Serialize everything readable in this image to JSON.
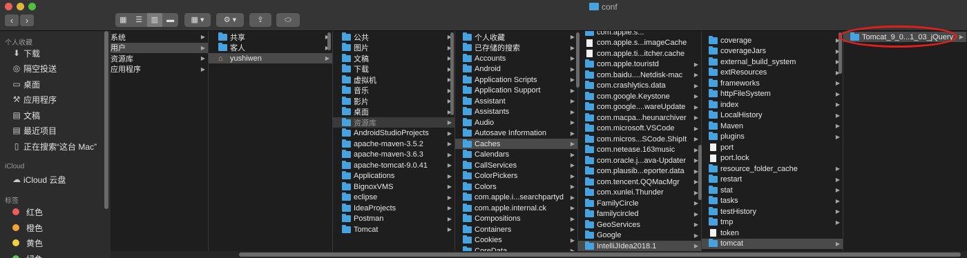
{
  "window": {
    "title": "conf"
  },
  "toolbar": {
    "back": "‹",
    "forward": "›",
    "view_icons": "▦",
    "view_list": "☰",
    "view_columns": "▥",
    "view_gallery": "▬",
    "arrange": "▦ ▾",
    "action": "⚙ ▾",
    "share": "⇪",
    "tag": "⬭"
  },
  "sidebar": {
    "favorites_header": "个人收藏",
    "favorites": [
      {
        "label": "下载",
        "icon": "download-icon",
        "glyph": "⬇"
      },
      {
        "label": "隔空投送",
        "icon": "airdrop-icon",
        "glyph": "◎"
      },
      {
        "label": "桌面",
        "icon": "desktop-icon",
        "glyph": "▭"
      },
      {
        "label": "应用程序",
        "icon": "applications-icon",
        "glyph": "⚒"
      },
      {
        "label": "文稿",
        "icon": "documents-icon",
        "glyph": "▤"
      },
      {
        "label": "最近项目",
        "icon": "recents-icon",
        "glyph": "▤"
      },
      {
        "label": "正在搜索“这台 Mac”",
        "icon": "search-file-icon",
        "glyph": "▯"
      }
    ],
    "icloud_header": "iCloud",
    "icloud": [
      {
        "label": "iCloud 云盘",
        "icon": "cloud-icon",
        "glyph": "☁"
      }
    ],
    "tags_header": "标签",
    "tags": [
      {
        "label": "红色",
        "color": "#ec5f57"
      },
      {
        "label": "橙色",
        "color": "#f0a33a"
      },
      {
        "label": "黄色",
        "color": "#f4d03f"
      },
      {
        "label": "绿色",
        "color": "#5cc451"
      }
    ]
  },
  "columns": {
    "c1": [
      {
        "label": "系统",
        "type": "none",
        "chev": true
      },
      {
        "label": "用户",
        "type": "none",
        "chev": true,
        "state": "selected"
      },
      {
        "label": "资源库",
        "type": "none",
        "chev": true
      },
      {
        "label": "应用程序",
        "type": "none",
        "chev": true
      }
    ],
    "c2": [
      {
        "label": "共享",
        "type": "folder",
        "chev": true
      },
      {
        "label": "客人",
        "type": "folder",
        "chev": true
      },
      {
        "label": "yushiwen",
        "type": "home",
        "chev": true,
        "state": "selected"
      }
    ],
    "c3": [
      {
        "label": "公共",
        "type": "folder",
        "chev": true
      },
      {
        "label": "图片",
        "type": "folder",
        "chev": true
      },
      {
        "label": "文稿",
        "type": "folder",
        "chev": true
      },
      {
        "label": "下载",
        "type": "folder",
        "chev": true
      },
      {
        "label": "虚拟机",
        "type": "folder",
        "chev": true
      },
      {
        "label": "音乐",
        "type": "folder",
        "chev": true
      },
      {
        "label": "影片",
        "type": "folder",
        "chev": true
      },
      {
        "label": "桌面",
        "type": "folder",
        "chev": true
      },
      {
        "label": "资源库",
        "type": "folder",
        "chev": true,
        "state": "sel-dim"
      },
      {
        "label": "AndroidStudioProjects",
        "type": "folder",
        "chev": true
      },
      {
        "label": "apache-maven-3.5.2",
        "type": "folder",
        "chev": true
      },
      {
        "label": "apache-maven-3.6.3",
        "type": "folder",
        "chev": true
      },
      {
        "label": "apache-tomcat-9.0.41",
        "type": "folder",
        "chev": true
      },
      {
        "label": "Applications",
        "type": "folder",
        "chev": true
      },
      {
        "label": "BignoxVMS",
        "type": "folder",
        "chev": true
      },
      {
        "label": "eclipse",
        "type": "folder",
        "chev": true
      },
      {
        "label": "IdeaProjects",
        "type": "folder",
        "chev": true
      },
      {
        "label": "Postman",
        "type": "folder",
        "chev": true
      },
      {
        "label": "Tomcat",
        "type": "folder",
        "chev": true
      }
    ],
    "c4": [
      {
        "label": "个人收藏",
        "type": "folder",
        "chev": true
      },
      {
        "label": "已存储的搜索",
        "type": "folder",
        "chev": true
      },
      {
        "label": "Accounts",
        "type": "folder",
        "chev": true
      },
      {
        "label": "Android",
        "type": "folder",
        "chev": true
      },
      {
        "label": "Application Scripts",
        "type": "folder",
        "chev": true
      },
      {
        "label": "Application Support",
        "type": "folder",
        "chev": true
      },
      {
        "label": "Assistant",
        "type": "folder",
        "chev": true
      },
      {
        "label": "Assistants",
        "type": "folder",
        "chev": true
      },
      {
        "label": "Audio",
        "type": "folder",
        "chev": true
      },
      {
        "label": "Autosave Information",
        "type": "folder",
        "chev": true
      },
      {
        "label": "Caches",
        "type": "folder",
        "chev": true,
        "state": "selected"
      },
      {
        "label": "Calendars",
        "type": "folder",
        "chev": true
      },
      {
        "label": "CallServices",
        "type": "folder",
        "chev": true
      },
      {
        "label": "ColorPickers",
        "type": "folder",
        "chev": true
      },
      {
        "label": "Colors",
        "type": "folder",
        "chev": true
      },
      {
        "label": "com.apple.i...searchpartyd",
        "type": "folder",
        "chev": true
      },
      {
        "label": "com.apple.internal.ck",
        "type": "folder",
        "chev": true
      },
      {
        "label": "Compositions",
        "type": "folder",
        "chev": true
      },
      {
        "label": "Containers",
        "type": "folder",
        "chev": true
      },
      {
        "label": "Cookies",
        "type": "folder",
        "chev": true
      },
      {
        "label": "CoreData",
        "type": "folder",
        "chev": true
      }
    ],
    "c5": [
      {
        "label": "com.apple.s...",
        "type": "folder",
        "chev": false
      },
      {
        "label": "com.apple.s...imageCache",
        "type": "file",
        "chev": false
      },
      {
        "label": "com.apple.ti...itcher.cache",
        "type": "file",
        "chev": false
      },
      {
        "label": "com.apple.touristd",
        "type": "folder",
        "chev": true
      },
      {
        "label": "com.baidu....Netdisk-mac",
        "type": "folder",
        "chev": true
      },
      {
        "label": "com.crashlytics.data",
        "type": "folder",
        "chev": true
      },
      {
        "label": "com.google.Keystone",
        "type": "folder",
        "chev": true
      },
      {
        "label": "com.google....wareUpdate",
        "type": "folder",
        "chev": true
      },
      {
        "label": "com.macpa...heunarchiver",
        "type": "folder",
        "chev": true
      },
      {
        "label": "com.microsoft.VSCode",
        "type": "folder",
        "chev": true
      },
      {
        "label": "com.micros...SCode.ShipIt",
        "type": "folder",
        "chev": true
      },
      {
        "label": "com.netease.163music",
        "type": "folder",
        "chev": true
      },
      {
        "label": "com.oracle.j...ava-Updater",
        "type": "folder",
        "chev": true
      },
      {
        "label": "com.plausib...eporter.data",
        "type": "folder",
        "chev": true
      },
      {
        "label": "com.tencent.QQMacMgr",
        "type": "folder",
        "chev": true
      },
      {
        "label": "com.xunlei.Thunder",
        "type": "folder",
        "chev": true
      },
      {
        "label": "FamilyCircle",
        "type": "folder",
        "chev": true
      },
      {
        "label": "familycircled",
        "type": "folder",
        "chev": true
      },
      {
        "label": "GeoServices",
        "type": "folder",
        "chev": true
      },
      {
        "label": "Google",
        "type": "folder",
        "chev": true
      },
      {
        "label": "IntelliJIdea2018.1",
        "type": "folder",
        "chev": true,
        "state": "selected"
      }
    ],
    "c6": [
      {
        "label": "coverage",
        "type": "folder",
        "chev": true
      },
      {
        "label": "coverageJars",
        "type": "folder",
        "chev": true
      },
      {
        "label": "external_build_system",
        "type": "folder",
        "chev": true
      },
      {
        "label": "extResources",
        "type": "folder",
        "chev": true
      },
      {
        "label": "frameworks",
        "type": "folder",
        "chev": true
      },
      {
        "label": "httpFileSystem",
        "type": "folder",
        "chev": true
      },
      {
        "label": "index",
        "type": "folder",
        "chev": true
      },
      {
        "label": "LocalHistory",
        "type": "folder",
        "chev": true
      },
      {
        "label": "Maven",
        "type": "folder",
        "chev": true
      },
      {
        "label": "plugins",
        "type": "folder",
        "chev": true
      },
      {
        "label": "port",
        "type": "file",
        "chev": false
      },
      {
        "label": "port.lock",
        "type": "file",
        "chev": false
      },
      {
        "label": "resource_folder_cache",
        "type": "folder",
        "chev": true
      },
      {
        "label": "restart",
        "type": "folder",
        "chev": true
      },
      {
        "label": "stat",
        "type": "folder",
        "chev": true
      },
      {
        "label": "tasks",
        "type": "folder",
        "chev": true
      },
      {
        "label": "testHistory",
        "type": "folder",
        "chev": true
      },
      {
        "label": "tmp",
        "type": "folder",
        "chev": true
      },
      {
        "label": "token",
        "type": "file",
        "chev": false
      },
      {
        "label": "tomcat",
        "type": "folder",
        "chev": true,
        "state": "selected"
      }
    ],
    "c7": [
      {
        "label": "Tomcat_9_0...1_03_jQuery",
        "type": "folder",
        "chev": true,
        "state": "selected"
      }
    ]
  }
}
